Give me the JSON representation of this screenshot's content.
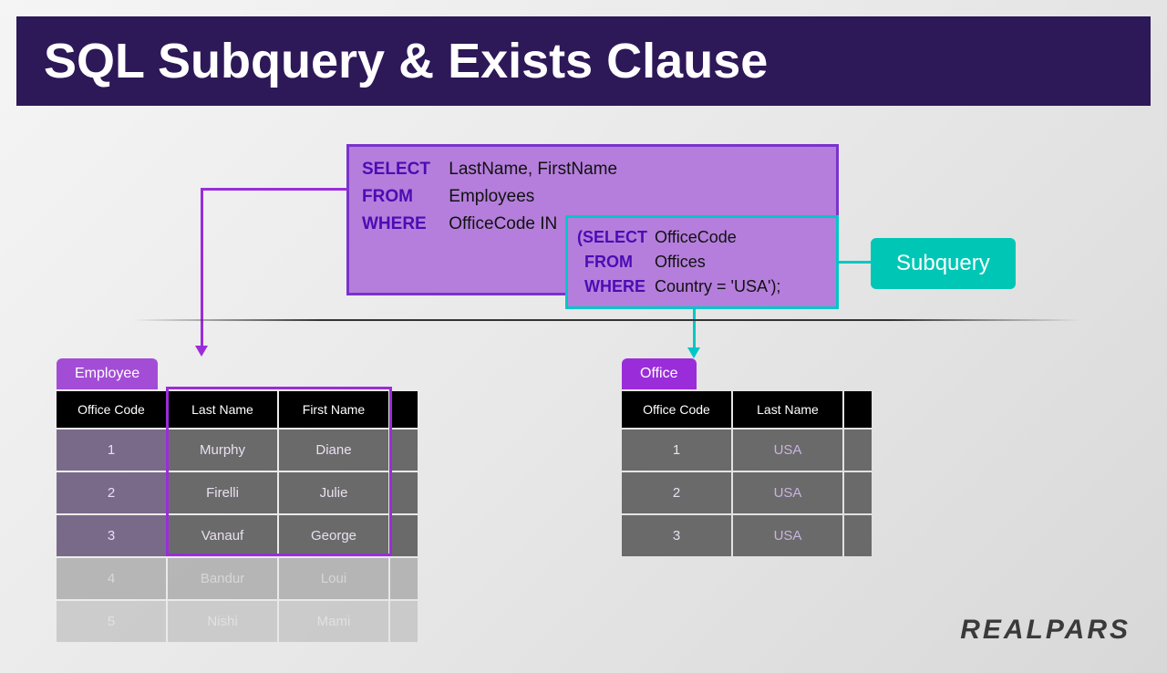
{
  "title": "SQL Subquery & Exists Clause",
  "query": {
    "select_kw": "SELECT",
    "select_val": "LastName, FirstName",
    "from_kw": "FROM",
    "from_val": "Employees",
    "where_kw": "WHERE",
    "where_val": "OfficeCode IN"
  },
  "subquery": {
    "select_kw": "(SELECT",
    "select_val": "OfficeCode",
    "from_kw": "FROM",
    "from_val": "Offices",
    "where_kw": "WHERE",
    "where_val": "Country = 'USA');"
  },
  "subquery_label": "Subquery",
  "employee_table": {
    "tab": "Employee",
    "headers": [
      "Office Code",
      "Last Name",
      "First Name"
    ],
    "rows": [
      [
        "1",
        "Murphy",
        "Diane"
      ],
      [
        "2",
        "Firelli",
        "Julie"
      ],
      [
        "3",
        "Vanauf",
        "George"
      ],
      [
        "4",
        "Bandur",
        "Loui"
      ],
      [
        "5",
        "Nishi",
        "Mami"
      ]
    ]
  },
  "office_table": {
    "tab": "Office",
    "headers": [
      "Office Code",
      "Last Name"
    ],
    "rows": [
      [
        "1",
        "USA"
      ],
      [
        "2",
        "USA"
      ],
      [
        "3",
        "USA"
      ]
    ]
  },
  "logo": "REALPARS"
}
